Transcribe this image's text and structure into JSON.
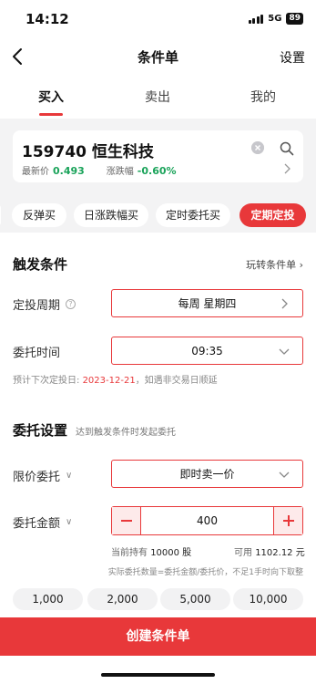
{
  "status": {
    "time": "14:12",
    "network": "5G",
    "battery": "89"
  },
  "nav": {
    "title": "条件单",
    "settings": "设置"
  },
  "tabs": [
    {
      "label": "买入"
    },
    {
      "label": "卖出"
    },
    {
      "label": "我的"
    }
  ],
  "stock": {
    "code_name": "159740 恒生科技",
    "price_label": "最新价",
    "price": "0.493",
    "change_label": "涨跌幅",
    "change": "-0.60%"
  },
  "chips": [
    {
      "label": "反弹买"
    },
    {
      "label": "日涨跌幅买"
    },
    {
      "label": "定时委托买"
    },
    {
      "label": "定期定投"
    }
  ],
  "trigger": {
    "title": "触发条件",
    "switch_link": "玩转条件单",
    "period_label": "定投周期",
    "period_value": "每周 星期四",
    "time_label": "委托时间",
    "time_value": "09:35",
    "next_prefix": "预计下次定投日:",
    "next_date": "2023-12-21",
    "next_suffix": "，如遇非交易日顺延"
  },
  "order": {
    "title": "委托设置",
    "hint": "达到触发条件时发起委托",
    "price_type_label": "限价委托",
    "price_type_value": "即时卖一价",
    "amount_label": "委托金额",
    "amount_value": "400",
    "holding_label": "当前持有",
    "holding_value": "10000 股",
    "available_label": "可用",
    "available_value": "1102.12 元",
    "actual_note": "实际委托数量=委托金额/委托价，不足1手时向下取整",
    "quick_amounts": [
      "1,000",
      "2,000",
      "5,000",
      "10,000"
    ]
  },
  "create_button": "创建条件单",
  "colors": {
    "accent": "#e8383a",
    "up_green": "#1aa35a"
  }
}
